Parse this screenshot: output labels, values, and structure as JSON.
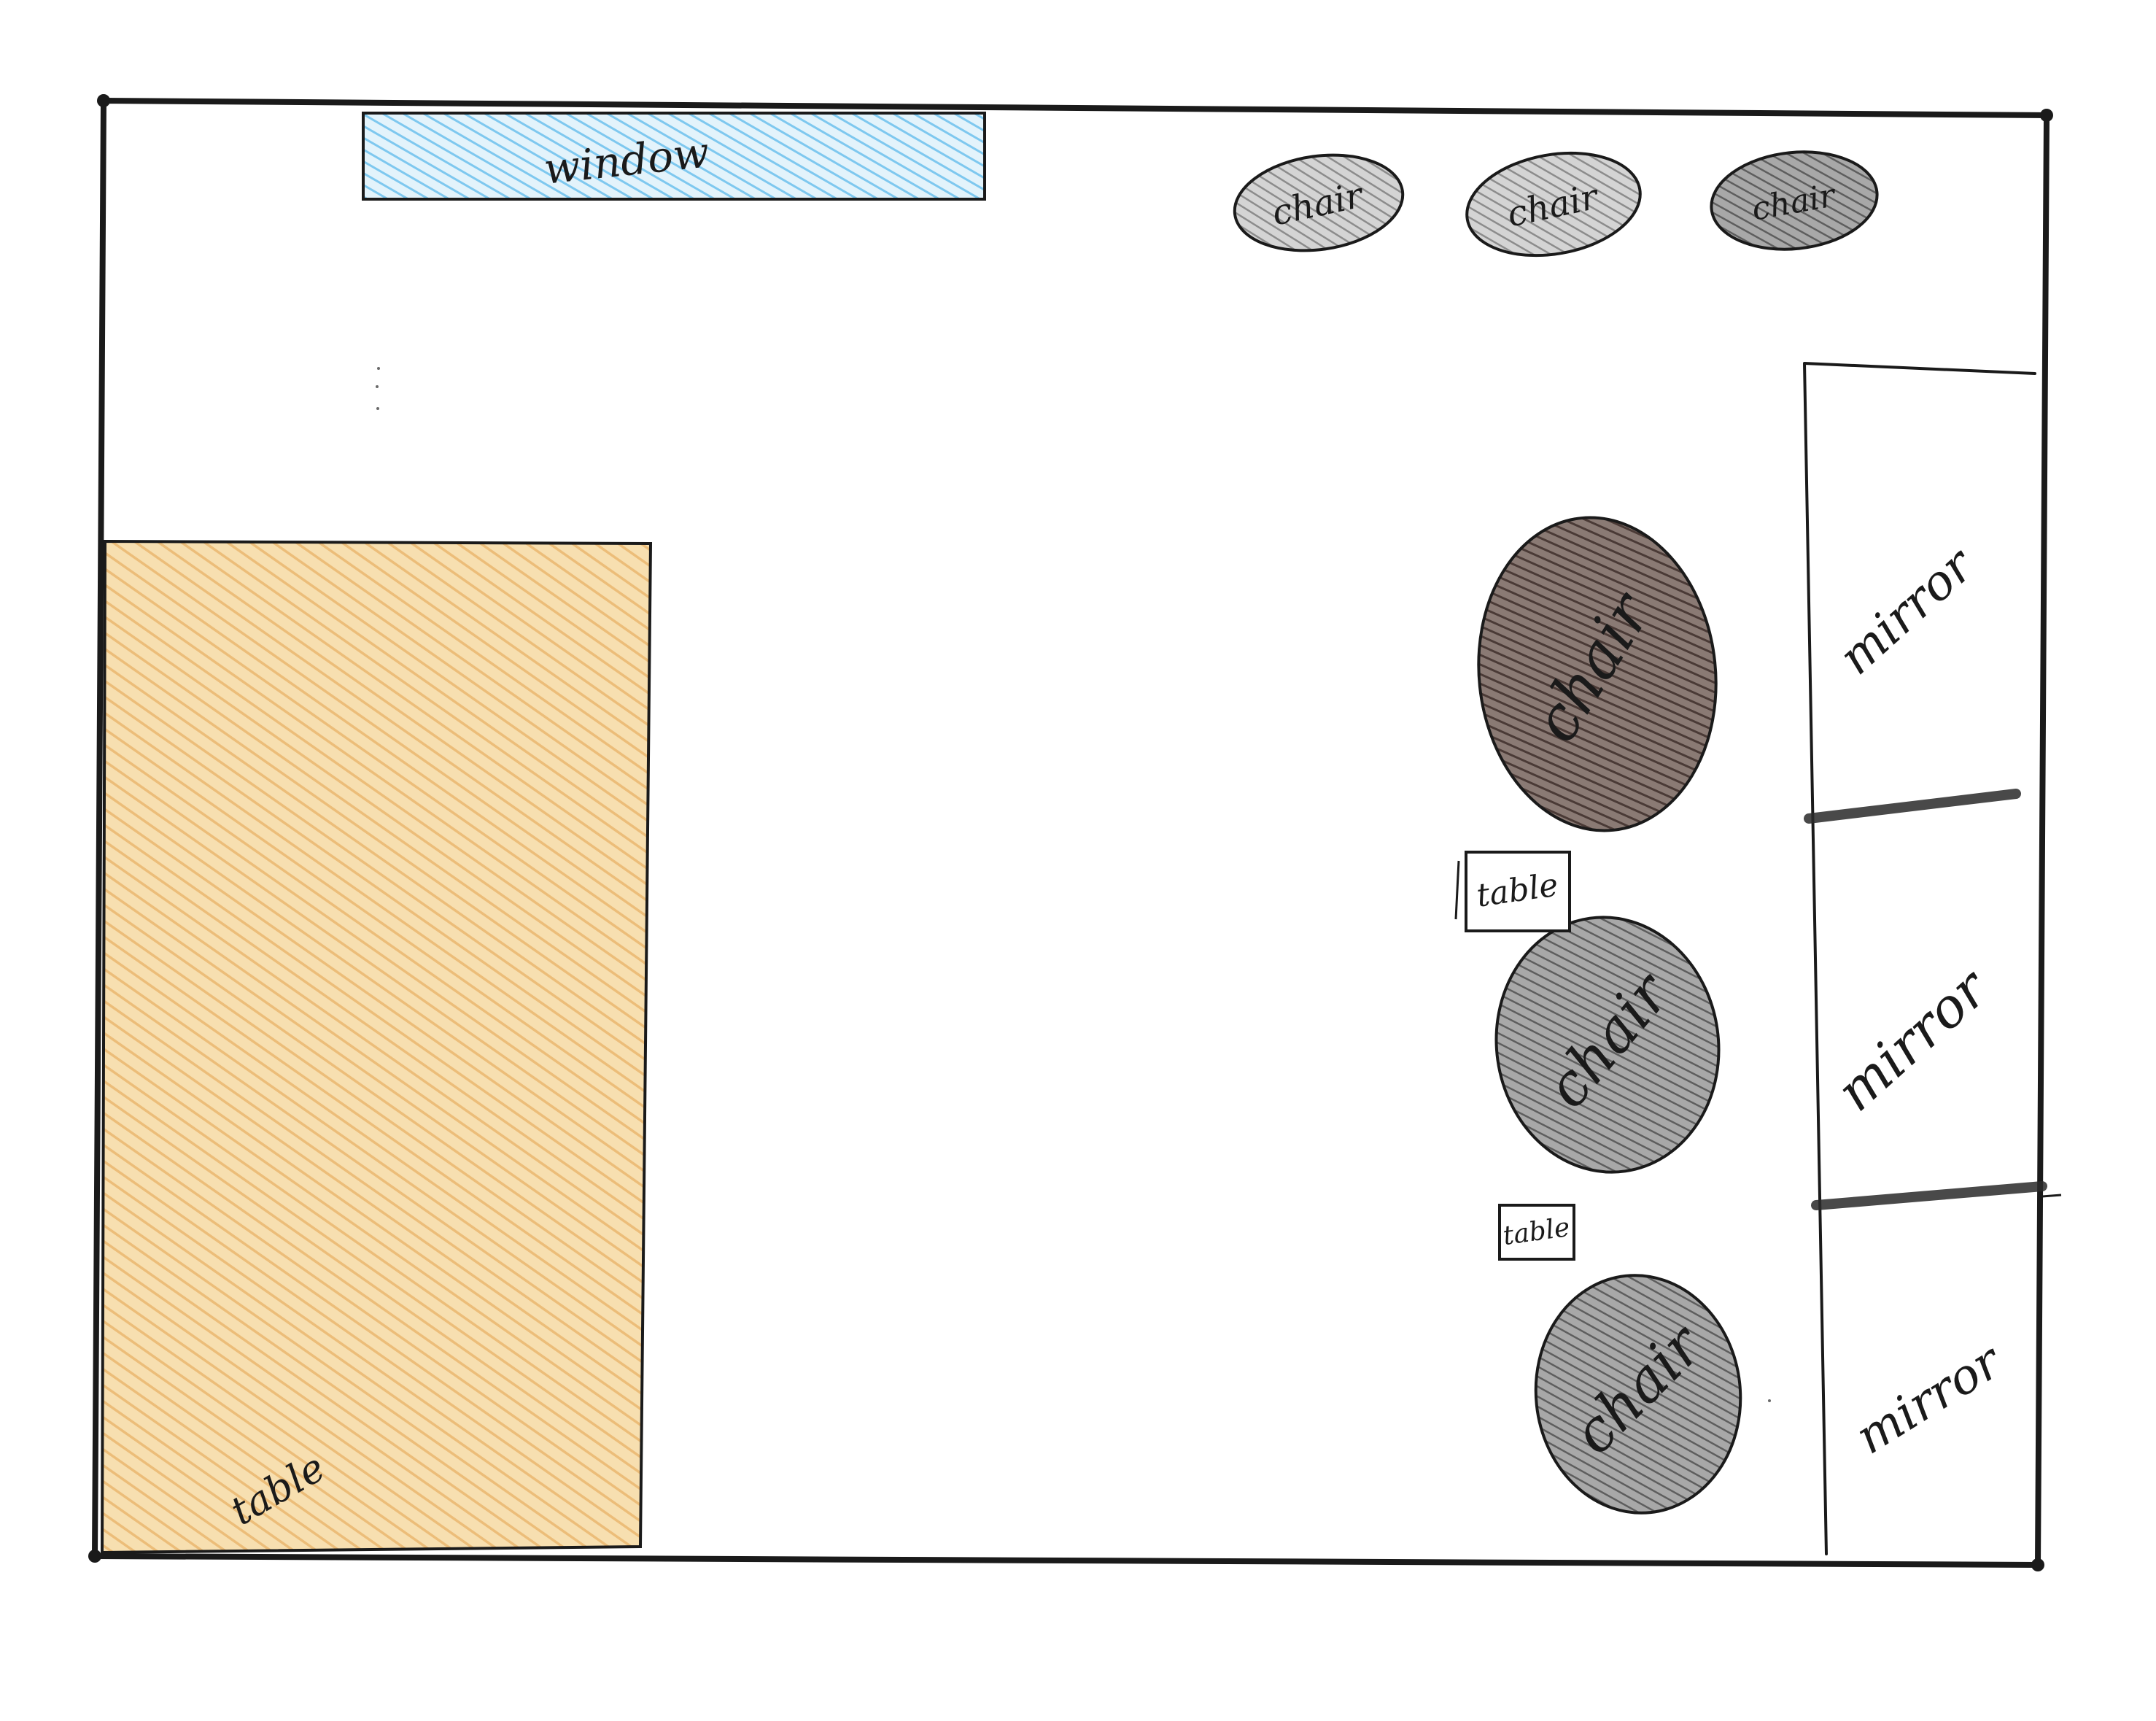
{
  "room": {
    "window": {
      "label": "window",
      "color": "#7ec8ef"
    },
    "top_chairs": [
      {
        "label": "chair"
      },
      {
        "label": "chair"
      },
      {
        "label": "chair"
      }
    ],
    "large_table": {
      "label": "table",
      "color": "#f2c98a"
    },
    "side_chairs": [
      {
        "label": "chair",
        "color": "#5a4a44"
      },
      {
        "label": "chair",
        "color": "#6a6a6a"
      },
      {
        "label": "chair",
        "color": "#6a6a6a"
      }
    ],
    "small_tables": [
      {
        "label": "table"
      },
      {
        "label": "table"
      }
    ],
    "mirrors": [
      {
        "label": "mirror"
      },
      {
        "label": "mirror"
      },
      {
        "label": "mirror"
      }
    ],
    "colors": {
      "ink": "#1a1a1a",
      "pencil_gray": "#8c8c8c",
      "light_gray": "#b8b8b8"
    }
  }
}
